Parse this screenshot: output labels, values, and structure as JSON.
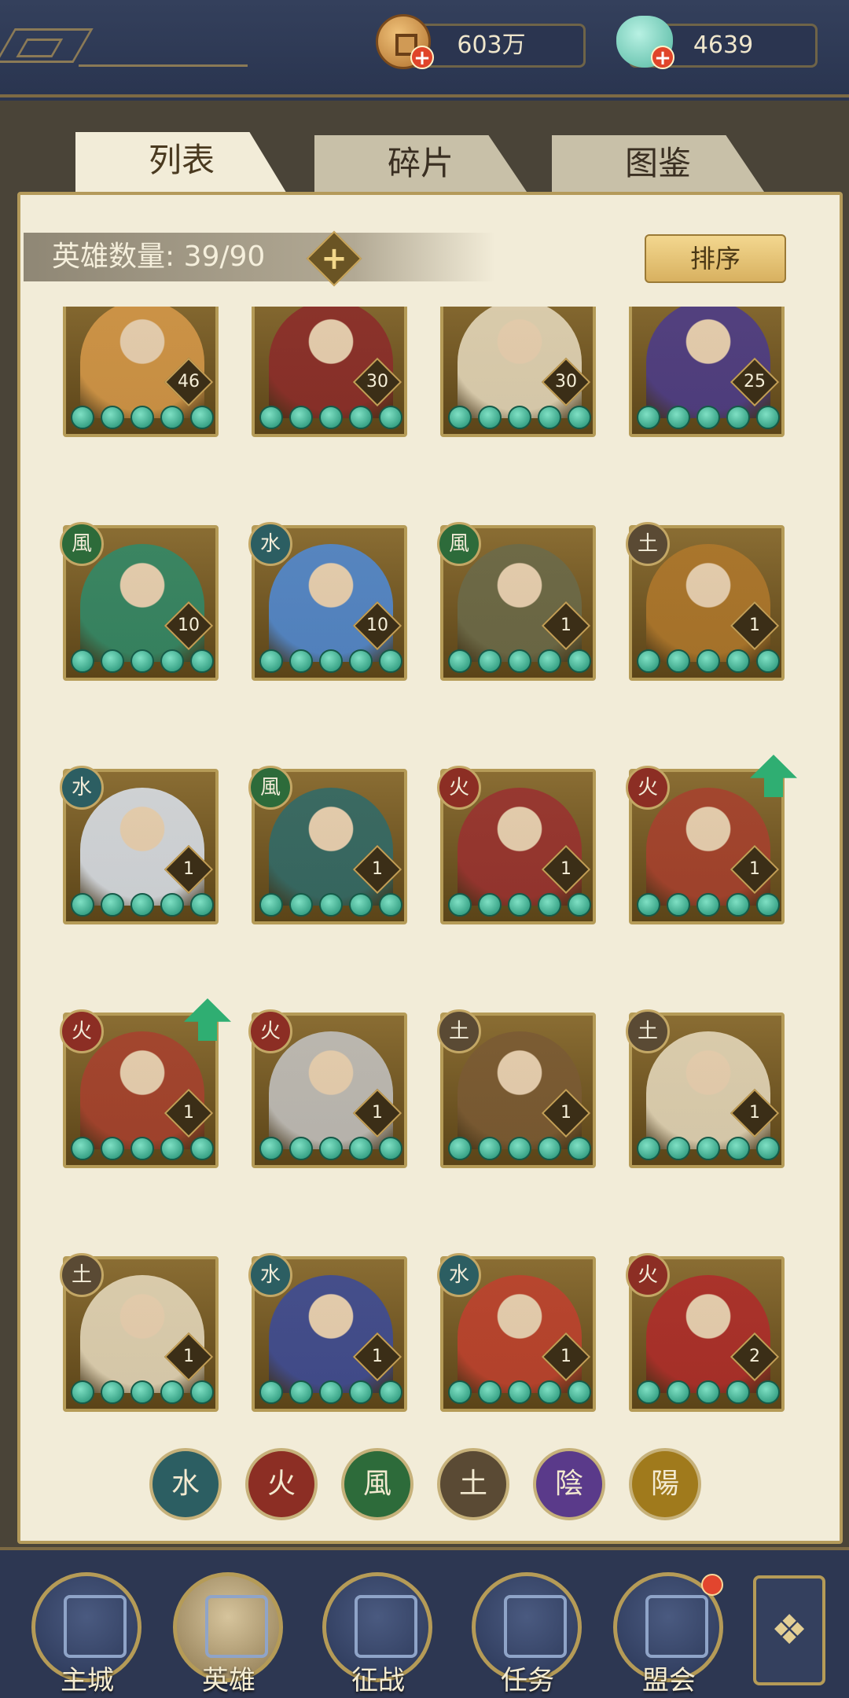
{
  "header": {
    "coins": "603万",
    "gems": "4639",
    "plus": "+"
  },
  "tabs": [
    {
      "label": "列表",
      "active": true
    },
    {
      "label": "碎片",
      "active": false
    },
    {
      "label": "图鉴",
      "active": false
    }
  ],
  "hero_count": {
    "label": "英雄数量:",
    "value": "39/90",
    "plus": "+"
  },
  "sort_label": "排序",
  "heroes": [
    {
      "element": "",
      "level": "46",
      "stars": 5,
      "color": "#d89a4a",
      "upgrade": false
    },
    {
      "element": "",
      "level": "30",
      "stars": 5,
      "color": "#8c2a2a",
      "upgrade": false
    },
    {
      "element": "",
      "level": "30",
      "stars": 5,
      "color": "#e8dcc0",
      "upgrade": false
    },
    {
      "element": "",
      "level": "25",
      "stars": 5,
      "color": "#4a3a8c",
      "upgrade": false
    },
    {
      "element": "風",
      "level": "10",
      "stars": 5,
      "color": "#2e8a6a",
      "upgrade": false
    },
    {
      "element": "水",
      "level": "10",
      "stars": 5,
      "color": "#4e8ad8",
      "upgrade": false
    },
    {
      "element": "風",
      "level": "1",
      "stars": 5,
      "color": "#6a6a4a",
      "upgrade": false
    },
    {
      "element": "土",
      "level": "1",
      "stars": 5,
      "color": "#b0782c",
      "upgrade": false
    },
    {
      "element": "水",
      "level": "1",
      "stars": 5,
      "color": "#dce4f0",
      "upgrade": false
    },
    {
      "element": "風",
      "level": "1",
      "stars": 5,
      "color": "#2e6a6a",
      "upgrade": false
    },
    {
      "element": "火",
      "level": "1",
      "stars": 5,
      "color": "#9a3030",
      "upgrade": false
    },
    {
      "element": "火",
      "level": "1",
      "stars": 5,
      "color": "#a8402e",
      "upgrade": true
    },
    {
      "element": "火",
      "level": "1",
      "stars": 5,
      "color": "#a8402e",
      "upgrade": true
    },
    {
      "element": "火",
      "level": "1",
      "stars": 5,
      "color": "#c4c4c4",
      "upgrade": false
    },
    {
      "element": "土",
      "level": "1",
      "stars": 5,
      "color": "#7a5a34",
      "upgrade": false
    },
    {
      "element": "土",
      "level": "1",
      "stars": 5,
      "color": "#e8dcc0",
      "upgrade": false
    },
    {
      "element": "土",
      "level": "1",
      "stars": 5,
      "color": "#e8dcc0",
      "upgrade": false
    },
    {
      "element": "水",
      "level": "1",
      "stars": 5,
      "color": "#3a4a9a",
      "upgrade": false
    },
    {
      "element": "水",
      "level": "1",
      "stars": 5,
      "color": "#c0402e",
      "upgrade": false
    },
    {
      "element": "火",
      "level": "2",
      "stars": 5,
      "color": "#b02a2a",
      "upgrade": false
    }
  ],
  "element_colors": {
    "水": "#2c5e62",
    "火": "#8c2e24",
    "風": "#2d6b3a",
    "土": "#5a4a34",
    "陰": "#5a3a8a",
    "陽": "#a07a1c"
  },
  "filters": [
    "水",
    "火",
    "風",
    "土",
    "陰",
    "陽"
  ],
  "nav": [
    {
      "label": "主城",
      "active": false,
      "dot": false
    },
    {
      "label": "英雄",
      "active": true,
      "dot": false
    },
    {
      "label": "征战",
      "active": false,
      "dot": false
    },
    {
      "label": "任务",
      "active": false,
      "dot": false
    },
    {
      "label": "盟会",
      "active": false,
      "dot": true
    }
  ]
}
